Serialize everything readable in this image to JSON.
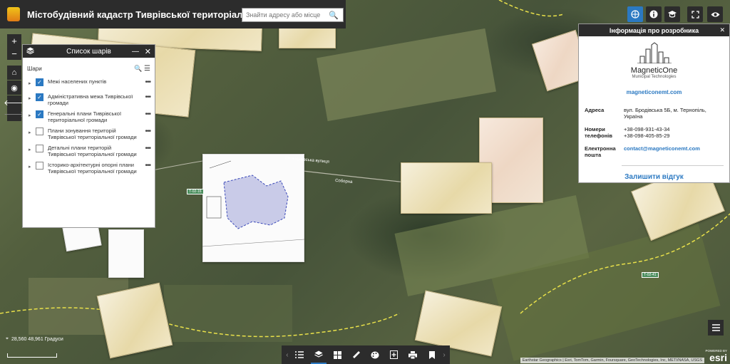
{
  "app": {
    "title": "Містобудівний кадастр Тиврівської територіальної громади"
  },
  "search": {
    "placeholder": "Знайти адресу або місце"
  },
  "layers_panel": {
    "title": "Список шарів",
    "subtitle": "Шари",
    "layers": [
      {
        "label": "Межі населених пунктів",
        "checked": true
      },
      {
        "label": "Адміністративна межа Тиврівської громади",
        "checked": true
      },
      {
        "label": "Генеральні плани Тиврівської територіальної громади",
        "checked": true
      },
      {
        "label": "Плани зонування територій Тиврівської територіальної громади",
        "checked": false
      },
      {
        "label": "Детальні плани територій Тиврівської територіальної громади",
        "checked": false
      },
      {
        "label": "Історико-архітектурні опорні плани Тиврівської територіальної громади",
        "checked": false
      }
    ]
  },
  "developer_panel": {
    "title": "Інформація про розробника",
    "brand_name": "MagneticOne",
    "brand_sub": "Municipal Technologies",
    "website": "magneticonemt.com",
    "address_label": "Адреса",
    "address": "вул. Бродівська 5Б, м. Тернопіль, Україна",
    "phones_label": "Номери телефонів",
    "phone_1": "+38-098-931-43-34",
    "phone_2": "+38-098-405-85-29",
    "email_label": "Електронна пошта",
    "email": "contact@magneticonemt.com",
    "feedback": "Залишити відгук"
  },
  "map": {
    "coordinates": "28,560 48,961 Градуси",
    "road_label": "Шевченківська вулиця",
    "road_label_2": "Соборна",
    "road_tags": [
      "Т-02-16",
      "Т-02-41"
    ],
    "attribution": "Earthstar Geographics | Esri, TomTom, Garmin, Foursquare, GeoTechnologies, Inc, METI/NASA, USGS",
    "esri_powered": "POWERED BY",
    "esri_name": "esri"
  },
  "icons": {
    "zoom_in": "+",
    "zoom_out": "−",
    "home": "⌂",
    "locate": "◉",
    "back": "🡐",
    "forward": "🡒",
    "search": "🔍",
    "close": "✕",
    "minimize": "—",
    "dots": "•••"
  }
}
